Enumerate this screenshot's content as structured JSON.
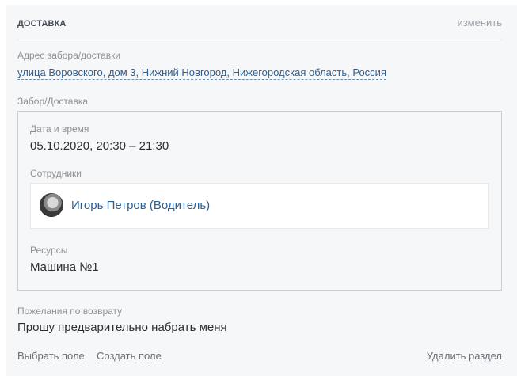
{
  "section": {
    "title": "ДОСТАВКА",
    "edit_label": "изменить"
  },
  "address": {
    "label": "Адрес забора/доставки",
    "value": "улица Воровского, дом 3, Нижний Новгород, Нижегородская область, Россия"
  },
  "pickup": {
    "label": "Забор/Доставка",
    "datetime_label": "Дата и время",
    "datetime_value": "05.10.2020, 20:30 – 21:30",
    "employees_label": "Сотрудники",
    "employees": [
      {
        "name": "Игорь Петров (Водитель)",
        "avatar_icon": "user-avatar"
      }
    ],
    "resources_label": "Ресурсы",
    "resources_value": "Машина №1"
  },
  "return_wishes": {
    "label": "Пожелания по возврату",
    "value": "Прошу предварительно набрать меня"
  },
  "footer": {
    "select_field_label": "Выбрать поле",
    "create_field_label": "Создать поле",
    "delete_section_label": "Удалить раздел"
  }
}
